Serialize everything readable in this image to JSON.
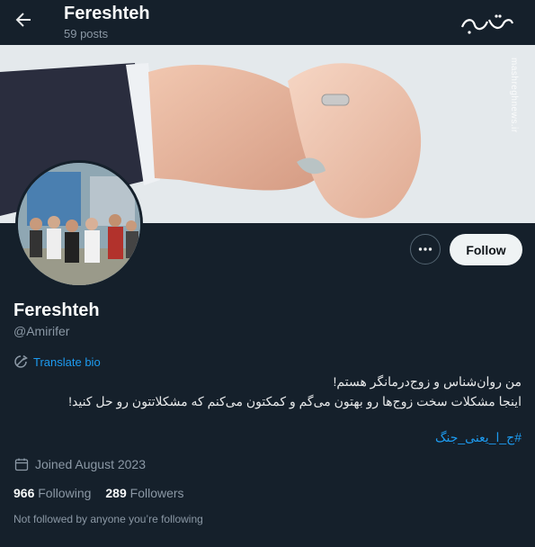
{
  "header": {
    "title": "Fereshteh",
    "posts": "59 posts"
  },
  "banner": {
    "watermark": "mashreghnews.ir",
    "brand_text": "مشرق"
  },
  "profile": {
    "name": "Fereshteh",
    "handle": "@Amirifer",
    "translate_label": "Translate bio",
    "bio_line1": "من روان‌شناس و زوج‌درمانگر هستم!",
    "bio_line2": "اینجا مشکلات سخت زوج‌ها رو بهتون می‌گم و کمکتون می‌کنم که مشکلاتتون رو حل کنید!",
    "hashtag": "#ج_ا_یعنی_جنگ",
    "joined": "Joined August 2023",
    "following_count": "966",
    "following_label": "Following",
    "followers_count": "289",
    "followers_label": "Followers",
    "not_followed": "Not followed by anyone you’re following"
  },
  "actions": {
    "follow_label": "Follow"
  },
  "colors": {
    "background": "#15202b",
    "accent": "#1d9bf0",
    "muted": "#8b98a5"
  }
}
